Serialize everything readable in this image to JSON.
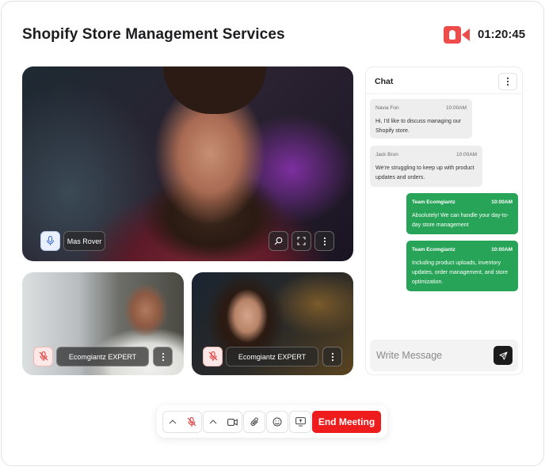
{
  "header": {
    "title": "Shopify Store Management Services",
    "timer": "01:20:45",
    "record_icon": "video-record-icon",
    "accent_color": "#ee4b4b"
  },
  "main_video": {
    "participant_name": "Mas Rover",
    "mic_state": "on",
    "controls": [
      "zoom-icon",
      "fullscreen-icon",
      "more-vertical-icon"
    ]
  },
  "small_videos": [
    {
      "participant_name": "Ecomgiantz EXPERT",
      "mic_state": "muted"
    },
    {
      "participant_name": "Ecomgiantz EXPERT",
      "mic_state": "muted"
    }
  ],
  "chat": {
    "title": "Chat",
    "messages": [
      {
        "sender": "Navia Fon",
        "time": "10:00AM",
        "text": "Hi, I'd like to discuss managing our Shopify store.",
        "direction": "incoming"
      },
      {
        "sender": "Jack Bron",
        "time": "10:00AM",
        "text": "We're struggling to keep up with product updates and orders.",
        "direction": "incoming"
      },
      {
        "sender": "Team Ecomgiantz",
        "time": "10:00AM",
        "text": "Absolutely! We can handle your day-to-day store management",
        "direction": "outgoing"
      },
      {
        "sender": "Team Ecomgiantz",
        "time": "10:00AM",
        "text": "Including product uploads, inventory updates, order management, and store optimization.",
        "direction": "outgoing"
      }
    ],
    "input_placeholder": "Write Message",
    "outgoing_color": "#27a457"
  },
  "toolbar": {
    "end_label": "End Meeting",
    "end_color": "#ee1c1c",
    "buttons": [
      "chevron-up-icon",
      "mic-off-icon",
      "chevron-up-icon",
      "camera-icon",
      "attachment-icon",
      "emoji-icon",
      "screen-share-icon"
    ]
  }
}
